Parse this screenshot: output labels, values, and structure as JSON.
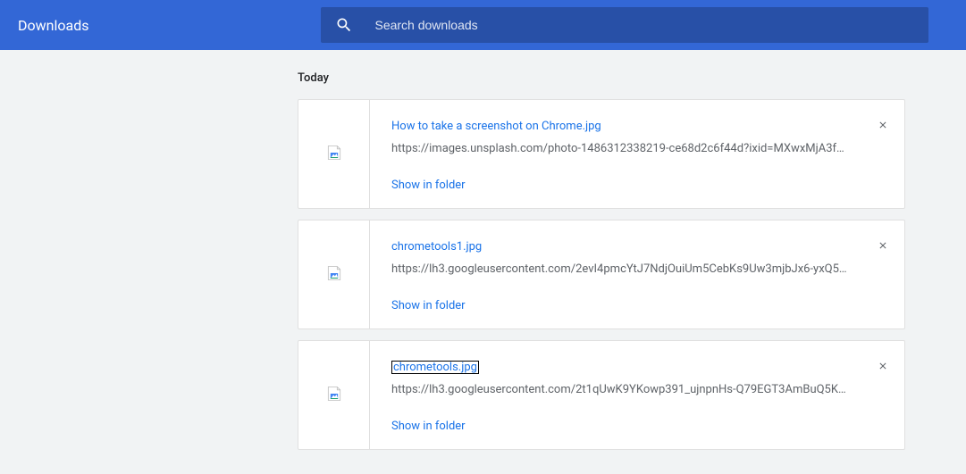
{
  "header": {
    "title": "Downloads"
  },
  "search": {
    "placeholder": "Search downloads",
    "value": ""
  },
  "section_label": "Today",
  "show_in_folder_label": "Show in folder",
  "downloads": [
    {
      "name": "How to take a screenshot on Chrome.jpg",
      "url": "https://images.unsplash.com/photo-1486312338219-ce68d2c6f44d?ixid=MXwxMjA3f…",
      "focused": false
    },
    {
      "name": "chrometools1.jpg",
      "url": "https://lh3.googleusercontent.com/2evI4pmcYtJ7NdjOuiUm5CebKs9Uw3mjbJx6-yxQ5…",
      "focused": false
    },
    {
      "name": "chrometools.jpg",
      "url": "https://lh3.googleusercontent.com/2t1qUwK9YKowp391_ujnpnHs-Q79EGT3AmBuQ5K…",
      "focused": true
    }
  ]
}
